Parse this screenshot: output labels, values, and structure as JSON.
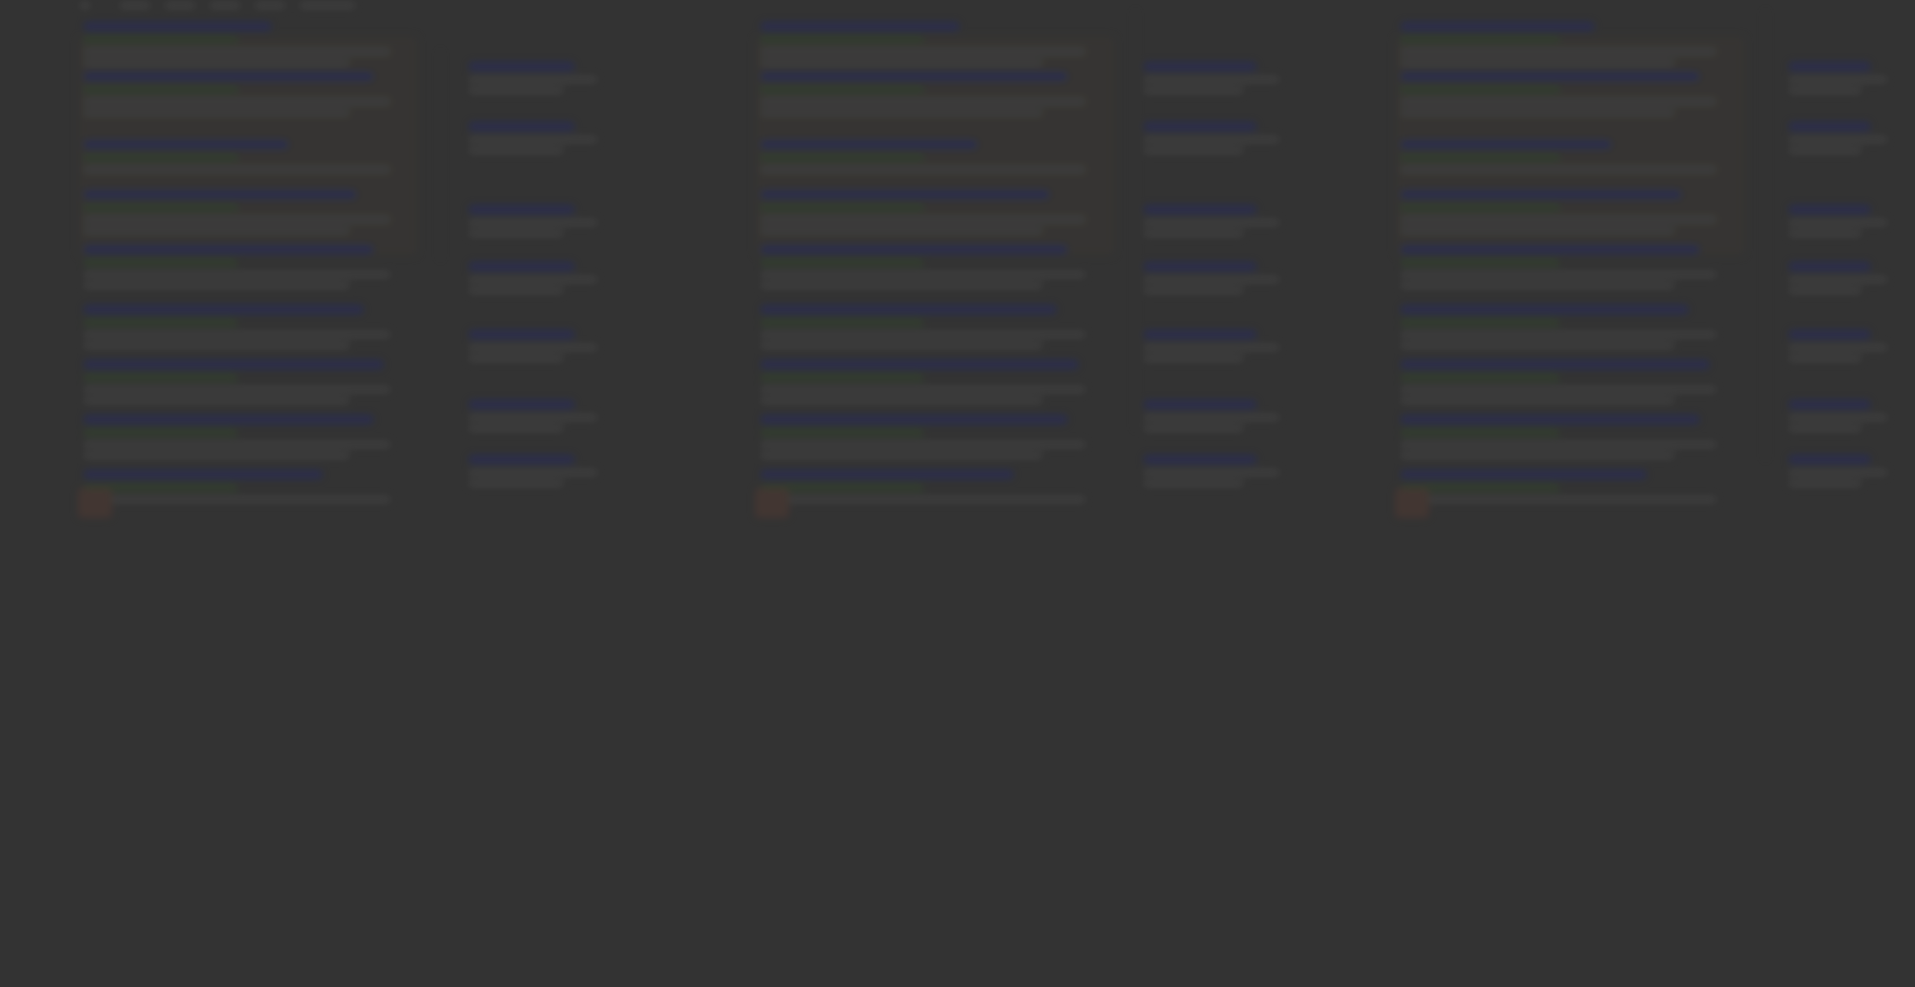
{
  "screen": {
    "description_text": "",
    "background_color": "#353535",
    "state": "blurred search-results content under a dark overlay; no text is legible"
  },
  "colors": {
    "link_color": "#2b2f57",
    "url_color": "#34452f",
    "snippet_color": "#454545",
    "thumbnail_color": "#4a3a34"
  },
  "panels": [
    {
      "name": "results-panel-1"
    },
    {
      "name": "sidebar-panel-1"
    },
    {
      "name": "results-panel-2"
    },
    {
      "name": "sidebar-panel-2"
    },
    {
      "name": "results-panel-3"
    },
    {
      "name": "sidebar-panel-3"
    }
  ]
}
